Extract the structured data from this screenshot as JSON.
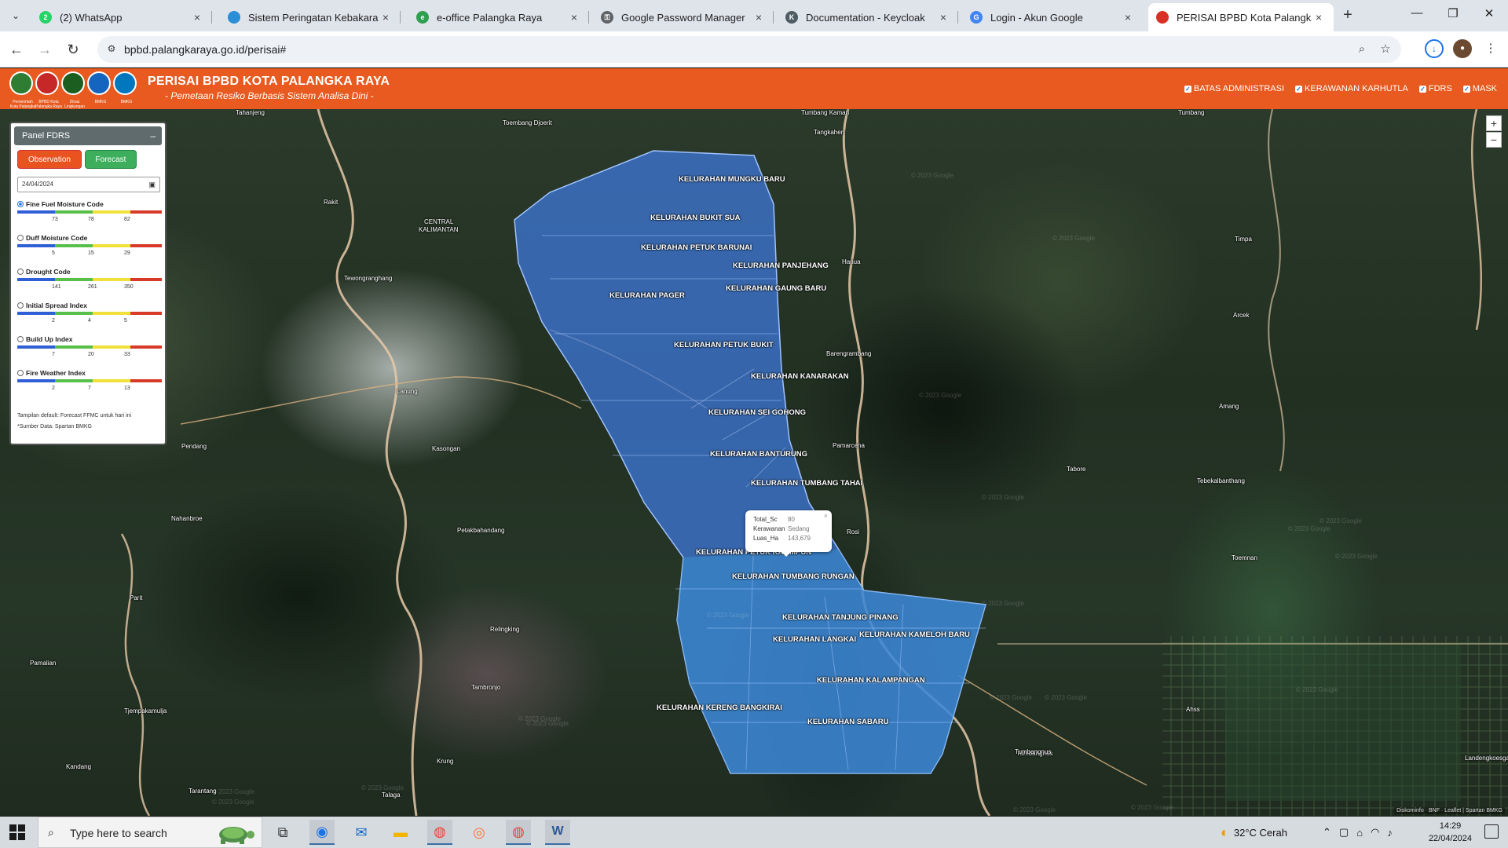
{
  "browser": {
    "tabs": [
      {
        "title": "(2) WhatsApp",
        "icon": "whatsapp-icon",
        "color": "#25d366",
        "glyph": "2"
      },
      {
        "title": "Sistem Peringatan Kebakaran H",
        "icon": "site-icon",
        "color": "#2a8fd6",
        "glyph": ""
      },
      {
        "title": "e-office Palangka Raya",
        "icon": "e-office-icon",
        "color": "#2e9e4f",
        "glyph": "e"
      },
      {
        "title": "Google Password Manager",
        "icon": "key-icon",
        "color": "#5f6368",
        "glyph": "⚿"
      },
      {
        "title": "Documentation - Keycloak",
        "icon": "keycloak-icon",
        "color": "#4d5b63",
        "glyph": "K"
      },
      {
        "title": "Login - Akun Google",
        "icon": "google-icon",
        "color": "#4285f4",
        "glyph": "G"
      },
      {
        "title": "PERISAI BPBD Kota Palangka R",
        "icon": "perisai-icon",
        "color": "#d93025",
        "glyph": ""
      }
    ],
    "url": "bpbd.palangkaraya.go.id/perisai#"
  },
  "app": {
    "title": "PERISAI BPBD KOTA PALANGKA RAYA",
    "subtitle": "- Pemetaan Resiko Berbasis Sistem Analisa Dini -",
    "logos": [
      {
        "caption": "Pemerintah Kota Palangka Raya",
        "color": "#2e7d32"
      },
      {
        "caption": "BPBD Kota Palangka Raya",
        "color": "#c62828"
      },
      {
        "caption": "Dinas Lingkungan Hidup",
        "color": "#1b5e20"
      },
      {
        "caption": "BMKG",
        "color": "#1565c0"
      },
      {
        "caption": "BMKG",
        "color": "#0277bd"
      }
    ],
    "layers": [
      {
        "label": "BATAS ADMINISTRASI",
        "checked": true
      },
      {
        "label": "KERAWANAN KARHUTLA",
        "checked": true
      },
      {
        "label": "FDRS",
        "checked": true
      },
      {
        "label": "MASK",
        "checked": true
      }
    ]
  },
  "panel": {
    "title": "Panel FDRS",
    "minimize": "–",
    "observation_label": "Observation",
    "forecast_label": "Forecast",
    "date_value": "24/04/2024",
    "indices": [
      {
        "label": "Fine Fuel Moisture Code",
        "selected": true,
        "ticks": [
          "73",
          "78",
          "82"
        ]
      },
      {
        "label": "Duff Moisture Code",
        "selected": false,
        "ticks": [
          "5",
          "15",
          "29"
        ]
      },
      {
        "label": "Drought Code",
        "selected": false,
        "ticks": [
          "141",
          "261",
          "350"
        ]
      },
      {
        "label": "Initial Spread Index",
        "selected": false,
        "ticks": [
          "2",
          "4",
          "5"
        ]
      },
      {
        "label": "Build Up Index",
        "selected": false,
        "ticks": [
          "7",
          "20",
          "33"
        ]
      },
      {
        "label": "Fire Weather Index",
        "selected": false,
        "ticks": [
          "2",
          "7",
          "13"
        ]
      }
    ],
    "scale_colors": [
      "#2f5fd6",
      "#58c04a",
      "#f2e03a",
      "#d83a2a"
    ],
    "note1": "Tampilan default: Forecast FFMC untuk hari ini",
    "note2": "*Sumber Data: Spartan BMKG"
  },
  "map": {
    "regions": [
      "KELURAHAN MUNGKU BARU",
      "KELURAHAN BUKIT SUA",
      "KELURAHAN PETUK BARUNAI",
      "KELURAHAN PANJEHANG",
      "KELURAHAN GAUNG BARU",
      "KELURAHAN PAGER",
      "KELURAHAN PETUK BUKIT",
      "KELURAHAN KANARAKAN",
      "KELURAHAN SEI GOHONG",
      "KELURAHAN BANTURUNG",
      "KELURAHAN TUMBANG TAHAI",
      "KELURAHAN PETUK KATIMPUN",
      "KELURAHAN TUMBANG RUNGAN",
      "KELURAHAN TANJUNG PINANG",
      "KELURAHAN LANGKAI",
      "KELURAHAN KAMELOH BARU",
      "KELURAHAN KALAMPANGAN",
      "KELURAHAN KERENG BANGKIRAI",
      "KELURAHAN SABARU"
    ],
    "places": [
      "Tangkahen",
      "Toembang Djoerit",
      "Rakit",
      "CENTRAL",
      "KALIMANTAN",
      "Tewongranghang",
      "Hanua",
      "Timpa",
      "Arcek",
      "Barengrambang",
      "Amang",
      "Tahanjeng",
      "Tumbang Kaman",
      "Tumbang",
      "Kasongan",
      "Pendang",
      "Tabore",
      "Tebekalbanthang",
      "Pamarcena",
      "Rosi",
      "Nahanbroe",
      "Petakbahandang",
      "Parit",
      "Tumbangnus",
      "Pamalian",
      "Relingking",
      "Tambronjo",
      "Tjempakamulja",
      "Toemnan",
      "Kandang",
      "Ahss",
      "Tarantang",
      "Talaga",
      "Krung",
      "Tumbangnus",
      "Landengkoesgan",
      "Lanung"
    ],
    "popup": {
      "close": "×",
      "rows": [
        {
          "key": "Total_Sc",
          "value": "80"
        },
        {
          "key": "Kerawanan",
          "value": "Sedang"
        },
        {
          "key": "Luas_Ha",
          "value": "143,679"
        }
      ]
    },
    "watermark": "© 2023 Google",
    "zoom_in": "+",
    "zoom_out": "−",
    "attribution": "Diskominfo · BNF · Leaflet | Spartan BMKG"
  },
  "taskbar": {
    "search_placeholder": "Type here to search",
    "weather": "32°C  Cerah",
    "time": "14:29",
    "date": "22/04/2024"
  }
}
